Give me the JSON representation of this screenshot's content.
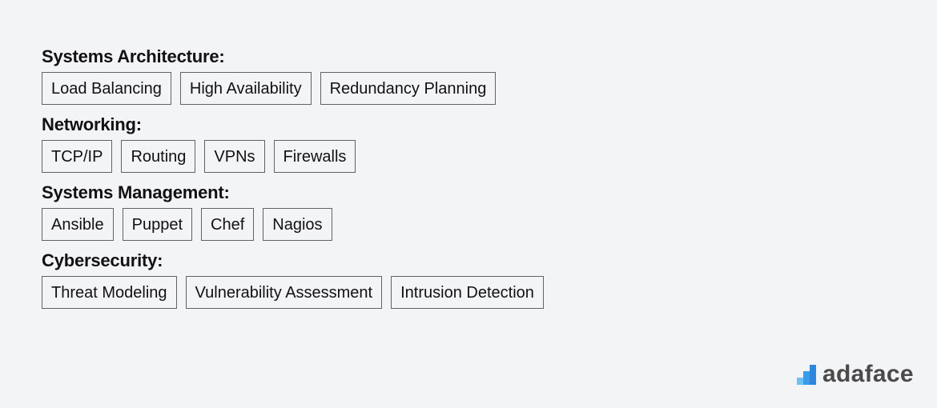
{
  "sections": [
    {
      "title": "Systems Architecture:",
      "tags": [
        "Load Balancing",
        "High Availability",
        "Redundancy Planning"
      ]
    },
    {
      "title": "Networking:",
      "tags": [
        "TCP/IP",
        "Routing",
        "VPNs",
        "Firewalls"
      ]
    },
    {
      "title": "Systems Management:",
      "tags": [
        "Ansible",
        "Puppet",
        "Chef",
        "Nagios"
      ]
    },
    {
      "title": "Cybersecurity:",
      "tags": [
        "Threat Modeling",
        "Vulnerability Assessment",
        "Intrusion Detection"
      ]
    }
  ],
  "logo": {
    "text": "adaface",
    "icon": "bar-chart-logo-icon",
    "accent_color": "#3b9be8"
  }
}
